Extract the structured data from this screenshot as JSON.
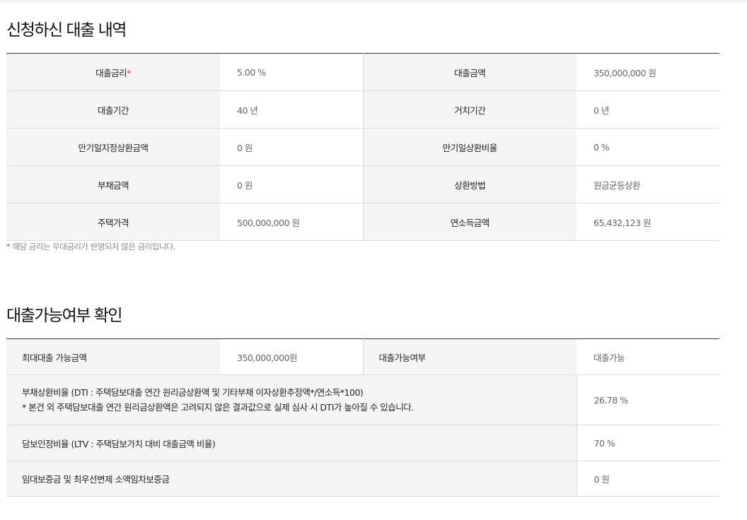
{
  "section1": {
    "title": "신청하신 대출 내역",
    "rows": [
      {
        "label1": "대출금리",
        "value1": "5.00 %",
        "label2": "대출금액",
        "value2": "350,000,000 원"
      },
      {
        "label1": "대출기간",
        "value1": "40 년",
        "label2": "거치기간",
        "value2": "0 년"
      },
      {
        "label1": "만기일지정상환금액",
        "value1": "0 원",
        "label2": "만기일상환비율",
        "value2": "0 %"
      },
      {
        "label1": "부채금액",
        "value1": "0 원",
        "label2": "상환방법",
        "value2": "원금균등상환"
      },
      {
        "label1": "주택가격",
        "value1": "500,000,000 원",
        "label2": "연소득금액",
        "value2": "65,432,123 원"
      }
    ],
    "required_mark": "*",
    "note_mark": "*",
    "note": "해당 금리는 우대금리가 반영되지 않은 금리입니다."
  },
  "section2": {
    "title": "대출가능여부 확인",
    "row1": {
      "label1": "최대대출 가능금액",
      "value1": "350,000,000원",
      "label2": "대출가능여부",
      "value2": "대출가능"
    },
    "dti": {
      "label": "부채상환비율 (DTI : 주택담보대출 연간 원리금상환액 및 기타부채 이자상환추정액*/연소득*100)",
      "sublabel": "* 본건 외 주택담보대출 연간 원리금상환액은 고려되지 않은 결과값으로 실제 심사 시 DTI가 높아질 수 있습니다.",
      "value": "26.78 %"
    },
    "ltv": {
      "label": "담보인정비율 (LTV : 주택담보가치 대비 대출금액 비율)",
      "value": "70 %"
    },
    "deposit": {
      "label": "임대보증금 및 최우선변제 소액임차보증금",
      "value": "0 원"
    }
  }
}
